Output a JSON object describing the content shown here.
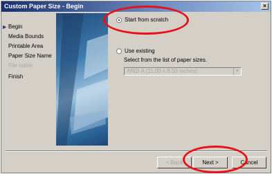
{
  "window": {
    "title": "Custom Paper Size - Begin",
    "close_label": "×"
  },
  "steps": [
    {
      "label": "Begin",
      "current": true
    },
    {
      "label": "Media Bounds",
      "current": false
    },
    {
      "label": "Printable Area",
      "current": false
    },
    {
      "label": "Paper Size Name",
      "current": false
    },
    {
      "label": "File name",
      "current": false,
      "disabled": true
    },
    {
      "label": "Finish",
      "current": false
    }
  ],
  "options": {
    "start_from_scratch": {
      "label": "Start from scratch",
      "selected": true
    },
    "use_existing": {
      "label": "Use existing",
      "selected": false
    }
  },
  "hint": "Select from the list of paper sizes.",
  "paper_select": {
    "value": "ANSI A (11.00 x 8.50 Inches)"
  },
  "buttons": {
    "back": "< Back",
    "next": "Next >",
    "cancel": "Cancel"
  },
  "colors": {
    "annotation": "#e8111a",
    "title_bar": "#1a2f6e"
  }
}
